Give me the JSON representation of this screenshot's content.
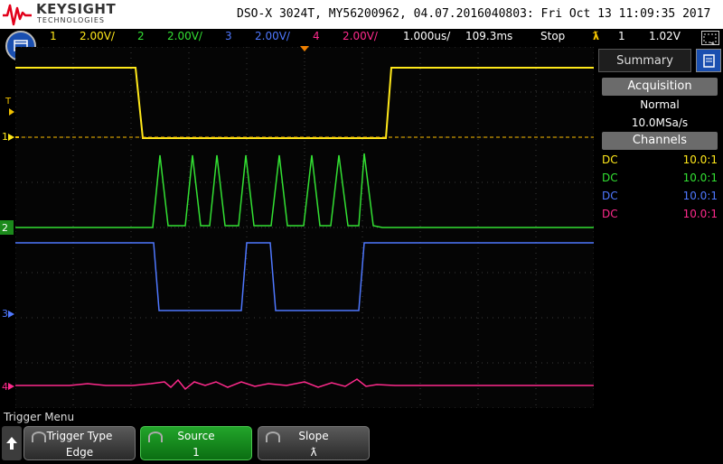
{
  "header": {
    "brand": "KEYSIGHT",
    "brand_sub": "TECHNOLOGIES",
    "device_info": "DSO-X 3024T, MY56200962, 04.07.2016040803: Fri Oct 13 11:09:35 2017"
  },
  "status": {
    "ch1_num": "1",
    "ch1_scale": "2.00V/",
    "ch2_num": "2",
    "ch2_scale": "2.00V/",
    "ch3_num": "3",
    "ch3_scale": "2.00V/",
    "ch4_num": "4",
    "ch4_scale": "2.00V/",
    "timebase": "1.000us/",
    "delay": "109.3ms",
    "run_state": "Stop",
    "trigger_source": "1",
    "trigger_level": "1.02V"
  },
  "markers": {
    "ch1": "1",
    "ch2": "2",
    "ch3": "3",
    "ch4": "4",
    "trigger": "T"
  },
  "sidebar": {
    "tab_summary": "Summary",
    "acquisition_header": "Acquisition",
    "acq_mode": "Normal",
    "acq_rate": "10.0MSa/s",
    "channels_header": "Channels",
    "channels": [
      {
        "coupling": "DC",
        "probe": "10.0:1",
        "color": "#ffff00"
      },
      {
        "coupling": "DC",
        "probe": "10.0:1",
        "color": "#00ff00"
      },
      {
        "coupling": "DC",
        "probe": "10.0:1",
        "color": "#5080ff"
      },
      {
        "coupling": "DC",
        "probe": "10.0:1",
        "color": "#ff3399"
      }
    ]
  },
  "softkeys": {
    "menu_title": "Trigger Menu",
    "trigger_type_label": "Trigger Type",
    "trigger_type_value": "Edge",
    "source_label": "Source",
    "source_value": "1",
    "slope_label": "Slope",
    "slope_value": "ƛ"
  },
  "colors": {
    "ch1": "#ffe81a",
    "ch2": "#33e033",
    "ch3": "#4f78ff",
    "ch4": "#ff2a8c",
    "trigger": "#f0c000"
  }
}
